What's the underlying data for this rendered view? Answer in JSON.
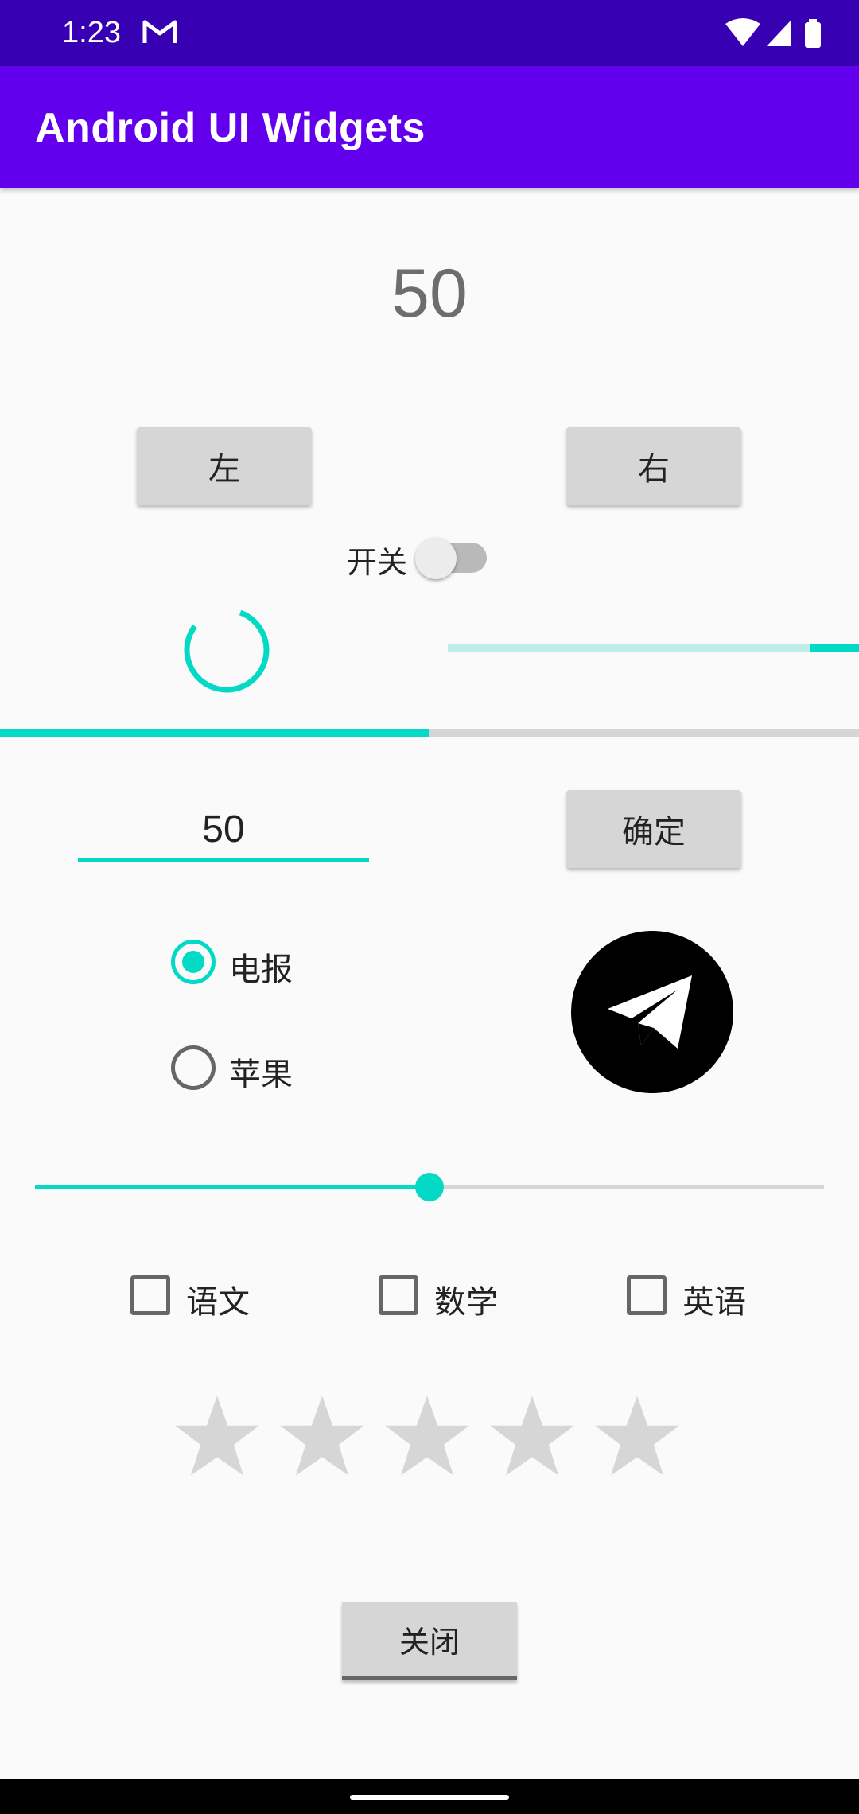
{
  "status_bar": {
    "time": "1:23"
  },
  "app_bar": {
    "title": "Android UI Widgets"
  },
  "main": {
    "value_display": "50",
    "left_button": "左",
    "right_button": "右",
    "switch": {
      "label": "开关",
      "on": false
    },
    "horizontal_progress": {
      "value": 0.12
    },
    "progress_bar": {
      "value": 0.5
    },
    "edit_text": {
      "value": "50"
    },
    "confirm_button": "确定",
    "radio_group": [
      {
        "label": "电报",
        "checked": true
      },
      {
        "label": "苹果",
        "checked": false
      }
    ],
    "image_icon": "telegram-icon",
    "seekbar": {
      "value": 50,
      "max": 100
    },
    "checkboxes": [
      {
        "label": "语文",
        "checked": false
      },
      {
        "label": "数学",
        "checked": false
      },
      {
        "label": "英语",
        "checked": false
      }
    ],
    "rating": {
      "value": 0,
      "max": 5
    },
    "close_button": "关闭"
  },
  "colors": {
    "status_bar": "#3700b3",
    "app_bar": "#6200ee",
    "accent": "#03dac5",
    "button_gray": "#d6d6d6"
  }
}
